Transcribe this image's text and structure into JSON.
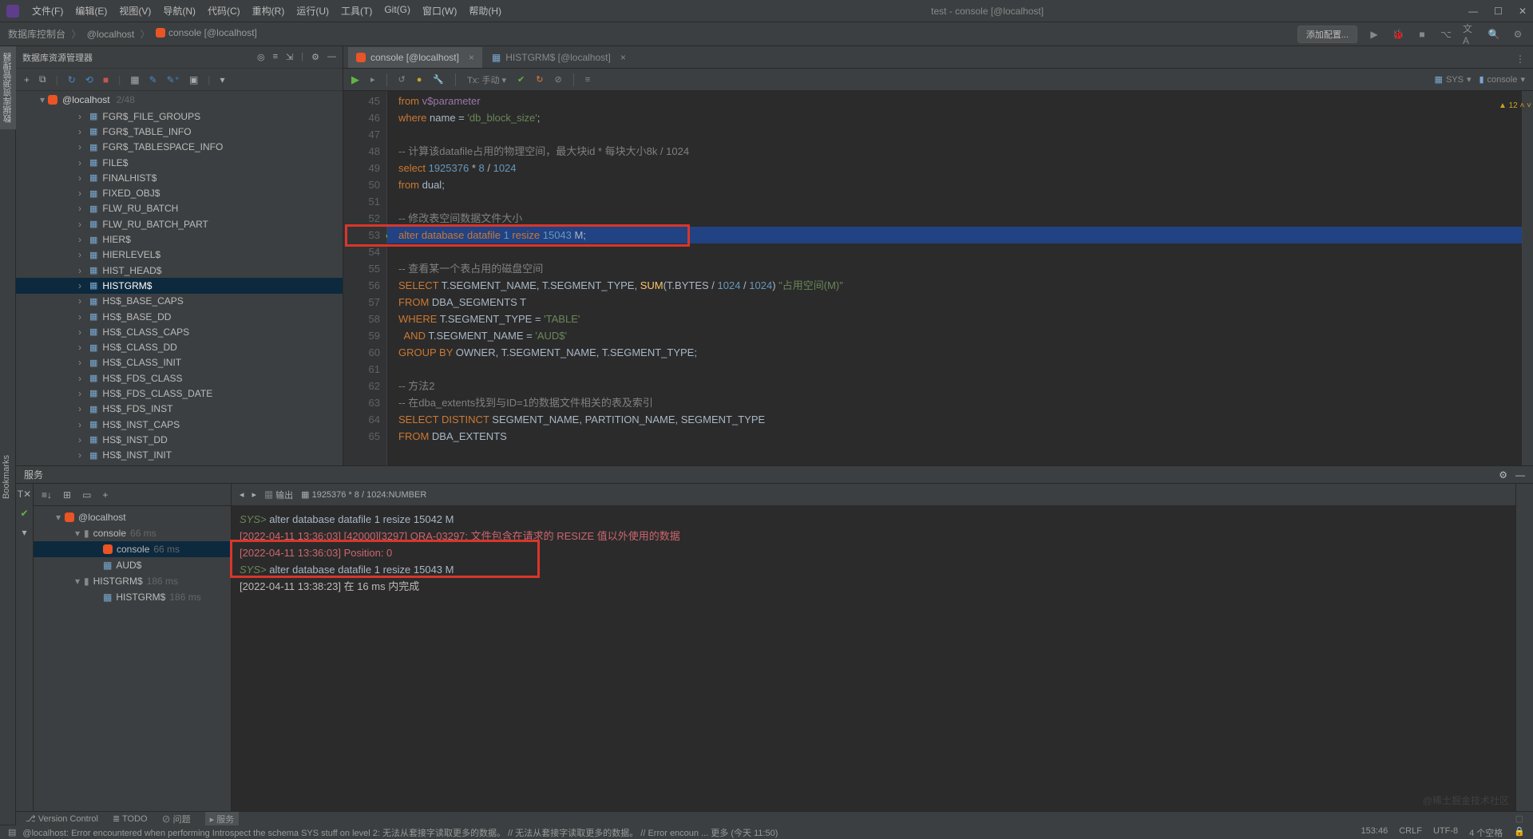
{
  "titlebar": {
    "menus": [
      "文件(F)",
      "编辑(E)",
      "视图(V)",
      "导航(N)",
      "代码(C)",
      "重构(R)",
      "运行(U)",
      "工具(T)",
      "Git(G)",
      "窗口(W)",
      "帮助(H)"
    ],
    "title": "test - console [@localhost]"
  },
  "breadcrumb": {
    "items": [
      "数据库控制台",
      "@localhost",
      "console [@localhost]"
    ],
    "addConfig": "添加配置..."
  },
  "leftStrip": {
    "tab1": "数据库资源管理器",
    "tab2": "Bookmarks"
  },
  "dbExplorer": {
    "title": "数据库资源管理器",
    "host": "@localhost",
    "count": "2/48",
    "tables": [
      "FGR$_FILE_GROUPS",
      "FGR$_TABLE_INFO",
      "FGR$_TABLESPACE_INFO",
      "FILE$",
      "FINALHIST$",
      "FIXED_OBJ$",
      "FLW_RU_BATCH",
      "FLW_RU_BATCH_PART",
      "HIER$",
      "HIERLEVEL$",
      "HIST_HEAD$",
      "HISTGRM$",
      "HS$_BASE_CAPS",
      "HS$_BASE_DD",
      "HS$_CLASS_CAPS",
      "HS$_CLASS_DD",
      "HS$_CLASS_INIT",
      "HS$_FDS_CLASS",
      "HS$_FDS_CLASS_DATE",
      "HS$_FDS_INST",
      "HS$_INST_CAPS",
      "HS$_INST_DD",
      "HS$_INST_INIT"
    ],
    "selected": "HISTGRM$"
  },
  "editor": {
    "tabs": [
      {
        "label": "console [@localhost]",
        "icon": "ora",
        "active": true
      },
      {
        "label": "HISTGRM$ [@localhost]",
        "icon": "tbl",
        "active": false
      }
    ],
    "toolbar": {
      "tx": "Tx: 手动",
      "sys": "SYS",
      "console": "console"
    },
    "warnCount": "12",
    "startLine": 45,
    "lines": [
      {
        "t": [
          [
            "kw",
            "from"
          ],
          [
            "txt",
            " "
          ],
          [
            "id",
            "v$parameter"
          ]
        ]
      },
      {
        "t": [
          [
            "kw",
            "where"
          ],
          [
            "txt",
            " name = "
          ],
          [
            "str",
            "'db_block_size'"
          ],
          [
            "txt",
            ";"
          ]
        ]
      },
      {
        "t": []
      },
      {
        "t": [
          [
            "cmt",
            "-- 计算该datafile占用的物理空间，最大块id * 每块大小8k / 1024"
          ]
        ]
      },
      {
        "t": [
          [
            "kw",
            "select"
          ],
          [
            "txt",
            " "
          ],
          [
            "num",
            "1925376"
          ],
          [
            "txt",
            " * "
          ],
          [
            "num",
            "8"
          ],
          [
            "txt",
            " / "
          ],
          [
            "num",
            "1024"
          ]
        ]
      },
      {
        "t": [
          [
            "kw",
            "from"
          ],
          [
            "txt",
            " dual;"
          ]
        ]
      },
      {
        "t": []
      },
      {
        "t": [
          [
            "cmt",
            "-- 修改表空间数据文件大小"
          ]
        ]
      },
      {
        "t": [
          [
            "kw",
            "alter database datafile"
          ],
          [
            "txt",
            " "
          ],
          [
            "num",
            "1"
          ],
          [
            "txt",
            " "
          ],
          [
            "kw",
            "resize"
          ],
          [
            "txt",
            " "
          ],
          [
            "num",
            "15043"
          ],
          [
            "txt",
            " M;"
          ]
        ],
        "hl": true,
        "chk": true
      },
      {
        "t": []
      },
      {
        "t": [
          [
            "cmt",
            "-- 查看某一个表占用的磁盘空间"
          ]
        ]
      },
      {
        "t": [
          [
            "kw",
            "SELECT"
          ],
          [
            "txt",
            " T.SEGMENT_NAME, T.SEGMENT_TYPE, "
          ],
          [
            "fn",
            "SUM"
          ],
          [
            "txt",
            "(T.BYTES / "
          ],
          [
            "num",
            "1024"
          ],
          [
            "txt",
            " / "
          ],
          [
            "num",
            "1024"
          ],
          [
            "txt",
            ") "
          ],
          [
            "str",
            "\"占用空间(M)\""
          ]
        ]
      },
      {
        "t": [
          [
            "kw",
            "FROM"
          ],
          [
            "txt",
            " DBA_SEGMENTS T"
          ]
        ]
      },
      {
        "t": [
          [
            "kw",
            "WHERE"
          ],
          [
            "txt",
            " T.SEGMENT_TYPE = "
          ],
          [
            "str",
            "'TABLE'"
          ]
        ]
      },
      {
        "t": [
          [
            "txt",
            "  "
          ],
          [
            "kw",
            "AND"
          ],
          [
            "txt",
            " T.SEGMENT_NAME = "
          ],
          [
            "str",
            "'AUD$'"
          ]
        ]
      },
      {
        "t": [
          [
            "kw",
            "GROUP BY"
          ],
          [
            "txt",
            " OWNER, T.SEGMENT_NAME, T.SEGMENT_TYPE;"
          ]
        ]
      },
      {
        "t": []
      },
      {
        "t": [
          [
            "cmt",
            "-- 方法2"
          ]
        ]
      },
      {
        "t": [
          [
            "cmt",
            "-- 在dba_extents找到与ID=1的数据文件相关的表及索引"
          ]
        ]
      },
      {
        "t": [
          [
            "kw",
            "SELECT DISTINCT"
          ],
          [
            "txt",
            " SEGMENT_NAME, PARTITION_NAME, SEGMENT_TYPE"
          ]
        ]
      },
      {
        "t": [
          [
            "kw",
            "FROM"
          ],
          [
            "txt",
            " DBA_EXTENTS"
          ]
        ]
      }
    ]
  },
  "services": {
    "title": "服务",
    "outputLabel": "输出",
    "formula": "1925376 * 8 / 1024:NUMBER",
    "tree": [
      {
        "lvl": 1,
        "chev": "▾",
        "icon": "ora",
        "label": "@localhost"
      },
      {
        "lvl": 2,
        "chev": "▾",
        "icon": "con",
        "label": "console",
        "ms": "66 ms"
      },
      {
        "lvl": 3,
        "icon": "ora",
        "label": "console",
        "ms": "66 ms",
        "sel": true
      },
      {
        "lvl": 3,
        "icon": "tbl",
        "label": "AUD$"
      },
      {
        "lvl": 2,
        "chev": "▾",
        "icon": "con",
        "label": "HISTGRM$",
        "ms": "186 ms"
      },
      {
        "lvl": 3,
        "icon": "tbl",
        "label": "HISTGRM$",
        "ms": "186 ms"
      }
    ],
    "console": [
      {
        "cls": "g",
        "pre": "SYS> ",
        "txt": "alter database datafile 1 resize 15042 M"
      },
      {
        "cls": "r",
        "txt": "[2022-04-11 13:36:03] [42000][3297] ORA-03297: 文件包含在请求的 RESIZE 值以外使用的数据"
      },
      {
        "cls": "r",
        "txt": "[2022-04-11 13:36:03] Position: 0"
      },
      {
        "cls": "g",
        "pre": "SYS> ",
        "txt": "alter database datafile 1 resize 15043 M"
      },
      {
        "cls": "w",
        "txt": "[2022-04-11 13:38:23] 在 16 ms 内完成"
      }
    ]
  },
  "toolWindows": {
    "vcs": "Version Control",
    "todo": "TODO",
    "problems": "问题",
    "services": "服务"
  },
  "status": {
    "msg": "@localhost: Error encountered when performing Introspect the schema SYS stuff on level 2: 无法从套接字读取更多的数据。 // 无法从套接字读取更多的数据。 // Error encoun ... 更多 (今天 11:50)",
    "pos": "153:46",
    "crlf": "CRLF",
    "enc": "UTF-8",
    "indent": "4 个空格"
  },
  "watermark": "@稀土掘金技术社区"
}
